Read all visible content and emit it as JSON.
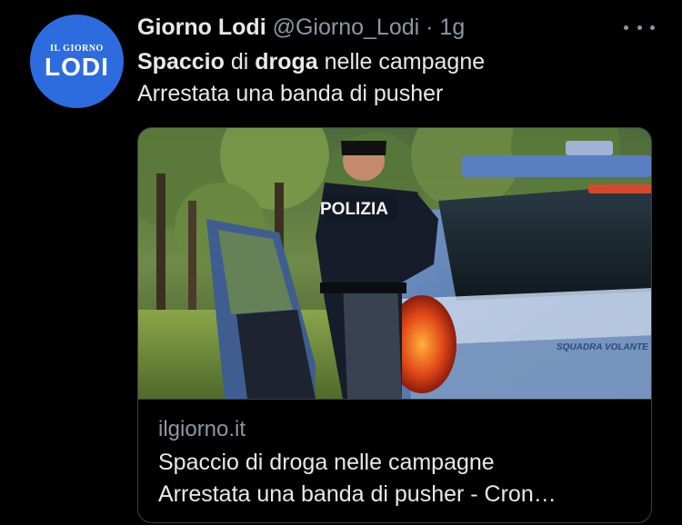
{
  "author": {
    "avatar_text_top": "IL GIORNO",
    "avatar_text_main": "LODI",
    "name": "Giorno Lodi",
    "handle": "@Giorno_Lodi",
    "separator": "·",
    "time": "1g"
  },
  "tweet": {
    "line1_part1": "Spaccio",
    "line1_part2": " di ",
    "line1_part3": "droga",
    "line1_part4": " nelle campagne",
    "line2": "Arrestata una banda di pusher"
  },
  "card": {
    "image_text_vest": "POLIZIA",
    "image_text_car": "SQUADRA VOLANTE",
    "domain": "ilgiorno.it",
    "title_line1": "Spaccio di droga nelle campagne",
    "title_line2": "Arrestata una banda di pusher - Cron…"
  },
  "icons": {
    "more": "more-horizontal-icon"
  },
  "colors": {
    "background": "#000000",
    "text_primary": "#e7e9ea",
    "text_secondary": "#8b98a5",
    "border": "#3a3f44",
    "avatar": "#2d6cdf"
  }
}
